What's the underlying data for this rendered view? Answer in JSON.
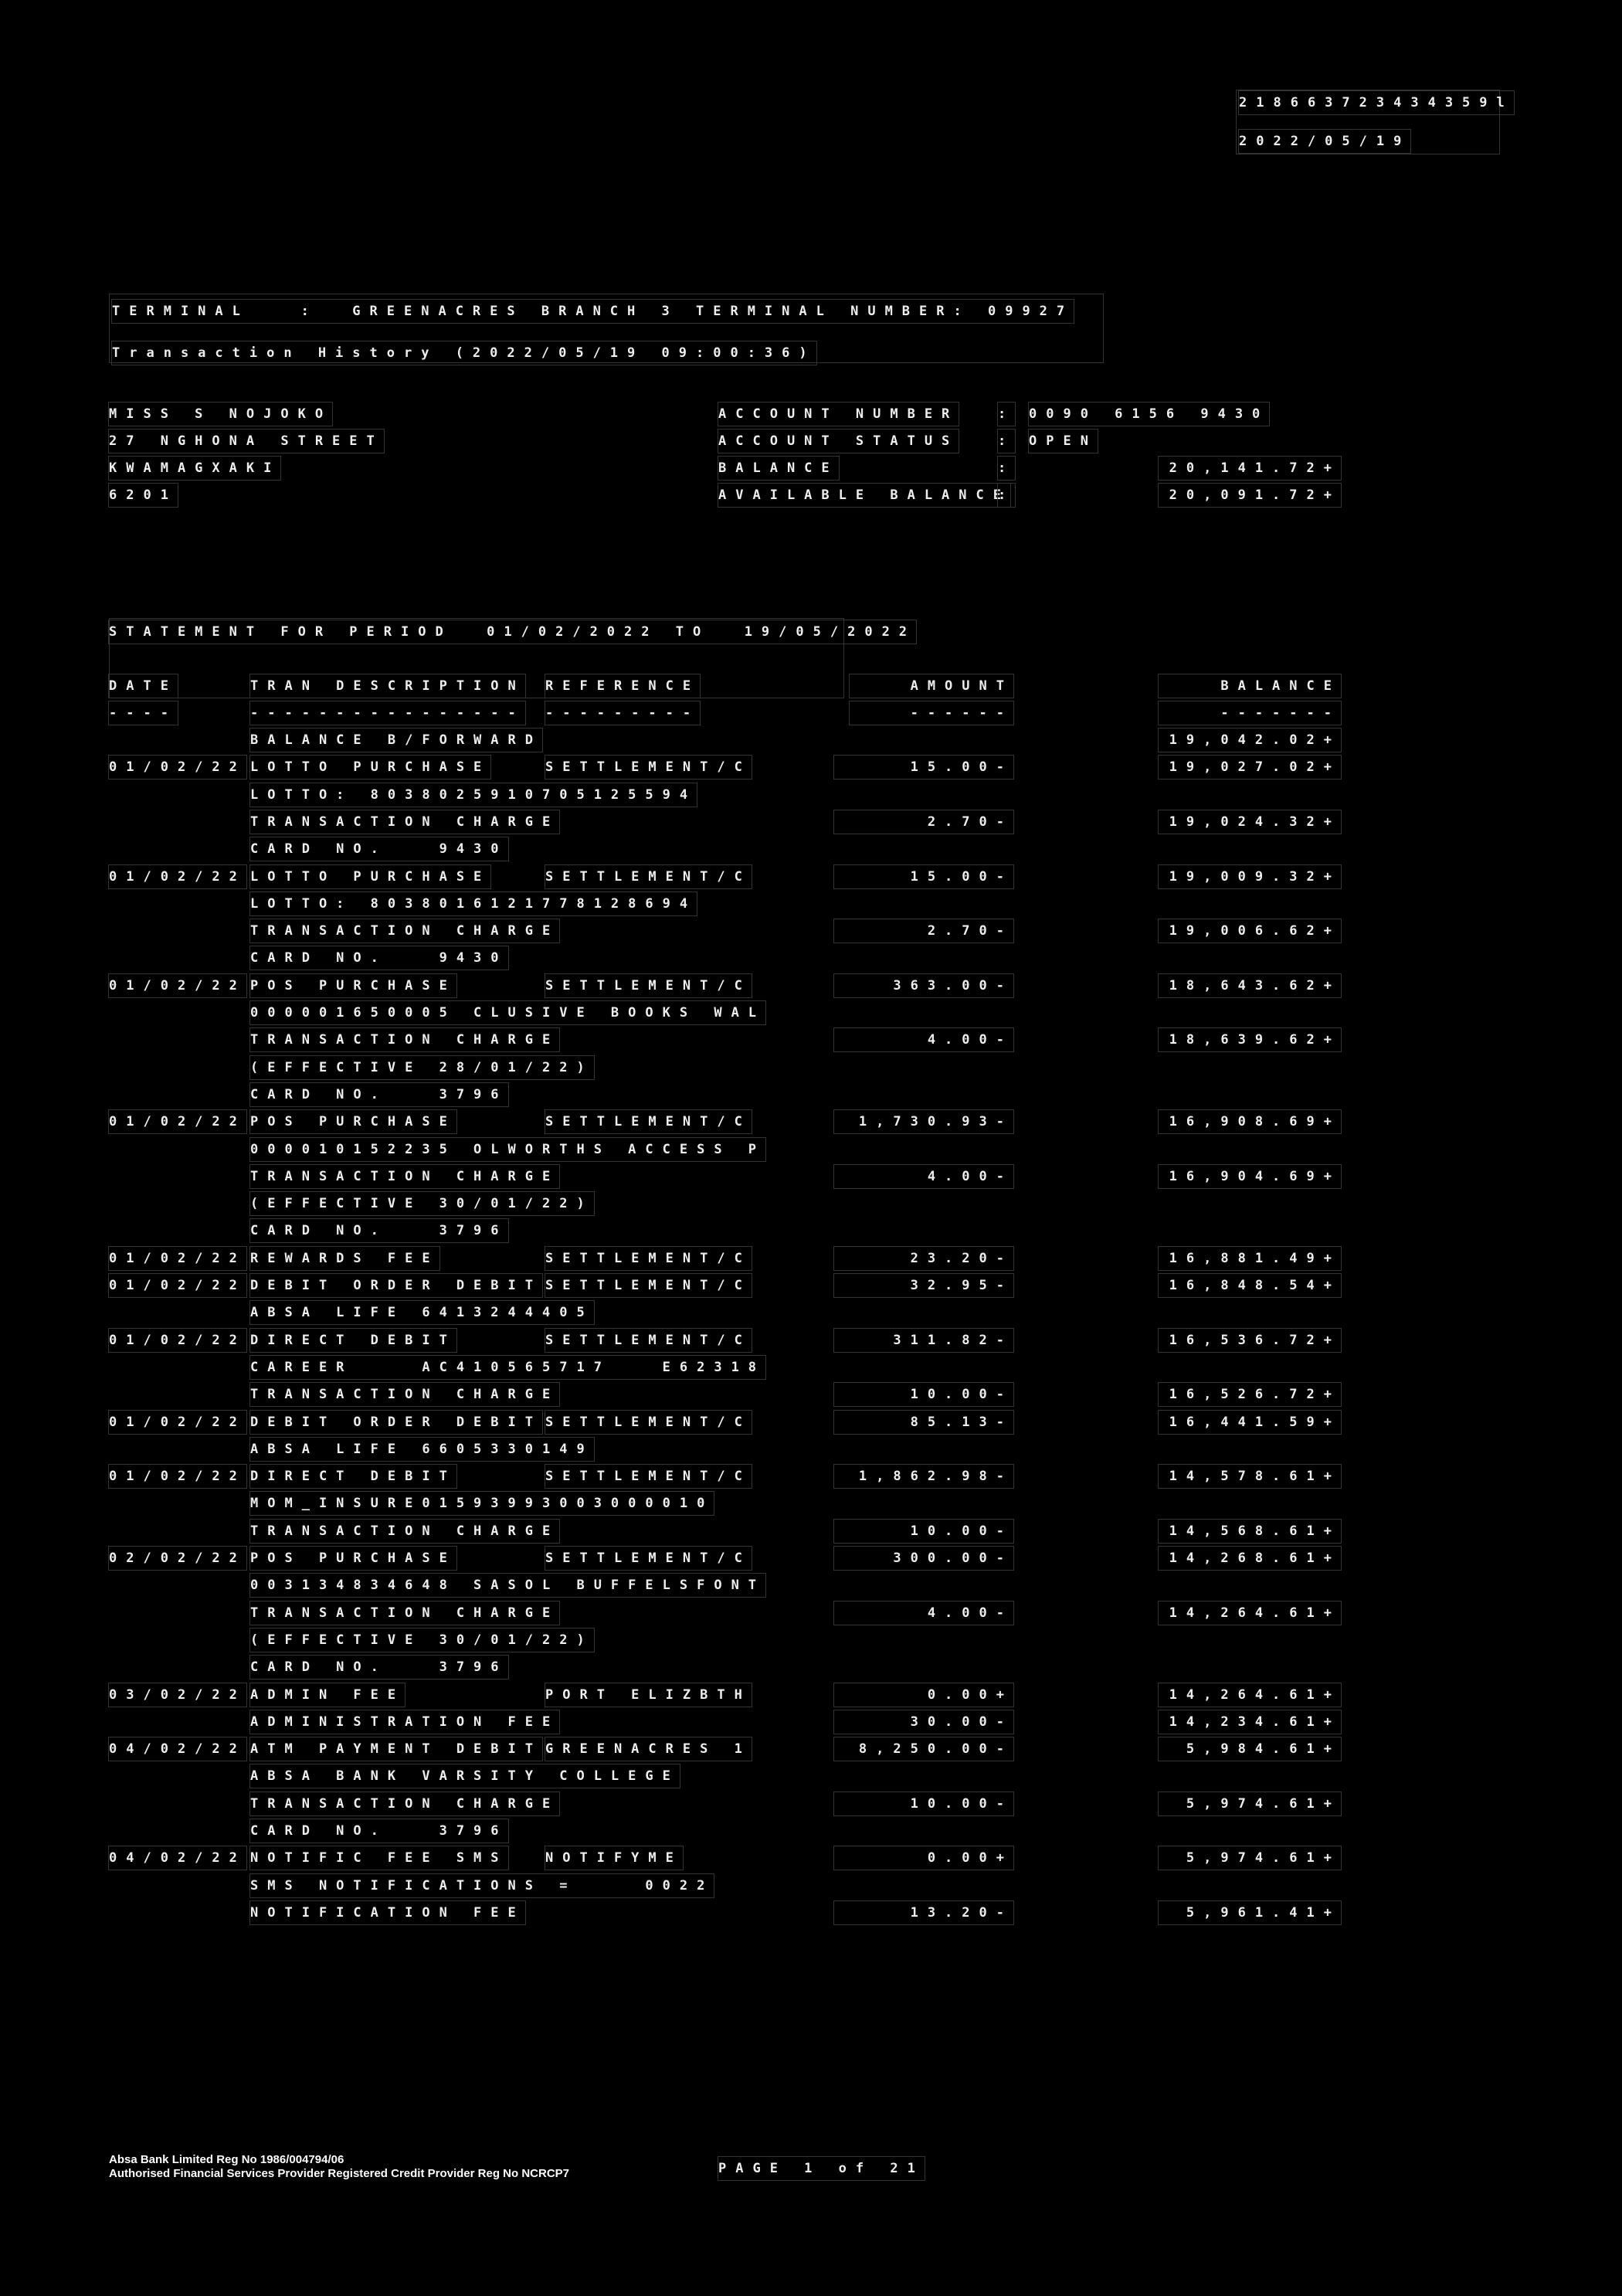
{
  "header": {
    "ref_number": "218663723434359l",
    "date": "2022/05/19",
    "terminal_line": "TERMINAL   :  GREENACRES BRANCH 3 TERMINAL NUMBER: 09927",
    "history_line": "Transaction History (2022/05/19 09:00:36)"
  },
  "customer": {
    "name": "MISS S NOJOKO",
    "address1": "27 NGHONA STREET",
    "address2": "KWAMAGXAKI",
    "postcode": "6201"
  },
  "account": {
    "number_label": "ACCOUNT NUMBER",
    "number": "0090 6156 9430",
    "status_label": "ACCOUNT STATUS",
    "status": "OPEN",
    "balance_label": "BALANCE",
    "balance": "20,141.72+",
    "available_label": "AVAILABLE BALANCE",
    "available": "20,091.72+",
    "colon": ":"
  },
  "statement": {
    "period": "STATEMENT FOR PERIOD  01/02/2022 TO  19/05/2022",
    "headers": {
      "date": "DATE",
      "desc": "TRAN DESCRIPTION",
      "ref": "REFERENCE",
      "amount": "AMOUNT",
      "balance": "BALANCE"
    },
    "dashes": {
      "date": "----",
      "desc": "----------------",
      "ref": "---------",
      "amount": "------",
      "balance": "-------"
    },
    "rows": [
      {
        "date": "",
        "desc": "BALANCE B/FORWARD",
        "ref": "",
        "amount": "",
        "balance": "19,042.02+"
      },
      {
        "date": "01/02/22",
        "desc": "LOTTO PURCHASE",
        "ref": "SETTLEMENT/C",
        "amount": "15.00-",
        "balance": "19,027.02+"
      },
      {
        "date": "",
        "desc": "LOTTO: 8038025910705125594",
        "ref": "",
        "amount": "",
        "balance": ""
      },
      {
        "date": "",
        "desc": "TRANSACTION CHARGE",
        "ref": "",
        "amount": "2.70-",
        "balance": "19,024.32+"
      },
      {
        "date": "",
        "desc": "CARD NO.   9430",
        "ref": "",
        "amount": "",
        "balance": ""
      },
      {
        "date": "01/02/22",
        "desc": "LOTTO PURCHASE",
        "ref": "SETTLEMENT/C",
        "amount": "15.00-",
        "balance": "19,009.32+"
      },
      {
        "date": "",
        "desc": "LOTTO: 8038016121778128694",
        "ref": "",
        "amount": "",
        "balance": ""
      },
      {
        "date": "",
        "desc": "TRANSACTION CHARGE",
        "ref": "",
        "amount": "2.70-",
        "balance": "19,006.62+"
      },
      {
        "date": "",
        "desc": "CARD NO.   9430",
        "ref": "",
        "amount": "",
        "balance": ""
      },
      {
        "date": "01/02/22",
        "desc": "POS PURCHASE",
        "ref": "SETTLEMENT/C",
        "amount": "363.00-",
        "balance": "18,643.62+"
      },
      {
        "date": "",
        "desc": "000001650005 CLUSIVE BOOKS WAL",
        "ref": "",
        "amount": "",
        "balance": ""
      },
      {
        "date": "",
        "desc": "TRANSACTION CHARGE",
        "ref": "",
        "amount": "4.00-",
        "balance": "18,639.62+"
      },
      {
        "date": "",
        "desc": "(EFFECTIVE 28/01/22)",
        "ref": "",
        "amount": "",
        "balance": ""
      },
      {
        "date": "",
        "desc": "CARD NO.   3796",
        "ref": "",
        "amount": "",
        "balance": ""
      },
      {
        "date": "01/02/22",
        "desc": "POS PURCHASE",
        "ref": "SETTLEMENT/C",
        "amount": "1,730.93-",
        "balance": "16,908.69+"
      },
      {
        "date": "",
        "desc": "000010152235 OLWORTHS ACCESS P",
        "ref": "",
        "amount": "",
        "balance": ""
      },
      {
        "date": "",
        "desc": "TRANSACTION CHARGE",
        "ref": "",
        "amount": "4.00-",
        "balance": "16,904.69+"
      },
      {
        "date": "",
        "desc": "(EFFECTIVE 30/01/22)",
        "ref": "",
        "amount": "",
        "balance": ""
      },
      {
        "date": "",
        "desc": "CARD NO.   3796",
        "ref": "",
        "amount": "",
        "balance": ""
      },
      {
        "date": "01/02/22",
        "desc": "REWARDS FEE",
        "ref": "SETTLEMENT/C",
        "amount": "23.20-",
        "balance": "16,881.49+"
      },
      {
        "date": "01/02/22",
        "desc": "DEBIT ORDER DEBIT",
        "ref": "SETTLEMENT/C",
        "amount": "32.95-",
        "balance": "16,848.54+"
      },
      {
        "date": "",
        "desc": "ABSA LIFE 6413244405",
        "ref": "",
        "amount": "",
        "balance": ""
      },
      {
        "date": "01/02/22",
        "desc": "DIRECT DEBIT",
        "ref": "SETTLEMENT/C",
        "amount": "311.82-",
        "balance": "16,536.72+"
      },
      {
        "date": "",
        "desc": "CAREER    AC410565717   E62318",
        "ref": "",
        "amount": "",
        "balance": ""
      },
      {
        "date": "",
        "desc": "TRANSACTION CHARGE",
        "ref": "",
        "amount": "10.00-",
        "balance": "16,526.72+"
      },
      {
        "date": "01/02/22",
        "desc": "DEBIT ORDER DEBIT",
        "ref": "SETTLEMENT/C",
        "amount": "85.13-",
        "balance": "16,441.59+"
      },
      {
        "date": "",
        "desc": "ABSA LIFE 6605330149",
        "ref": "",
        "amount": "",
        "balance": ""
      },
      {
        "date": "01/02/22",
        "desc": "DIRECT DEBIT",
        "ref": "SETTLEMENT/C",
        "amount": "1,862.98-",
        "balance": "14,578.61+"
      },
      {
        "date": "",
        "desc": "MOM_INSURE01593993003000010",
        "ref": "",
        "amount": "",
        "balance": ""
      },
      {
        "date": "",
        "desc": "TRANSACTION CHARGE",
        "ref": "",
        "amount": "10.00-",
        "balance": "14,568.61+"
      },
      {
        "date": "02/02/22",
        "desc": "POS PURCHASE",
        "ref": "SETTLEMENT/C",
        "amount": "300.00-",
        "balance": "14,268.61+"
      },
      {
        "date": "",
        "desc": "003134834648 SASOL BUFFELSFONT",
        "ref": "",
        "amount": "",
        "balance": ""
      },
      {
        "date": "",
        "desc": "TRANSACTION CHARGE",
        "ref": "",
        "amount": "4.00-",
        "balance": "14,264.61+"
      },
      {
        "date": "",
        "desc": "(EFFECTIVE 30/01/22)",
        "ref": "",
        "amount": "",
        "balance": ""
      },
      {
        "date": "",
        "desc": "CARD NO.   3796",
        "ref": "",
        "amount": "",
        "balance": ""
      },
      {
        "date": "03/02/22",
        "desc": "ADMIN FEE",
        "ref": "PORT ELIZBTH",
        "amount": "0.00+",
        "balance": "14,264.61+"
      },
      {
        "date": "",
        "desc": "ADMINISTRATION FEE",
        "ref": "",
        "amount": "30.00-",
        "balance": "14,234.61+"
      },
      {
        "date": "04/02/22",
        "desc": "ATM PAYMENT DEBIT",
        "ref": "GREENACRES 1",
        "amount": "8,250.00-",
        "balance": "5,984.61+"
      },
      {
        "date": "",
        "desc": "ABSA BANK VARSITY COLLEGE",
        "ref": "",
        "amount": "",
        "balance": ""
      },
      {
        "date": "",
        "desc": "TRANSACTION CHARGE",
        "ref": "",
        "amount": "10.00-",
        "balance": "5,974.61+"
      },
      {
        "date": "",
        "desc": "CARD NO.   3796",
        "ref": "",
        "amount": "",
        "balance": ""
      },
      {
        "date": "04/02/22",
        "desc": "NOTIFIC FEE SMS",
        "ref": "NOTIFYME",
        "amount": "0.00+",
        "balance": "5,974.61+"
      },
      {
        "date": "",
        "desc": "SMS NOTIFICATIONS =    0022",
        "ref": "",
        "amount": "",
        "balance": ""
      },
      {
        "date": "",
        "desc": "NOTIFICATION FEE",
        "ref": "",
        "amount": "13.20-",
        "balance": "5,961.41+"
      }
    ]
  },
  "footer": {
    "line1": "Absa Bank Limited Reg No 1986/004794/06",
    "line2": "Authorised Financial Services Provider Registered Credit Provider Reg No NCRCP7",
    "page": "PAGE 1 of 21"
  }
}
